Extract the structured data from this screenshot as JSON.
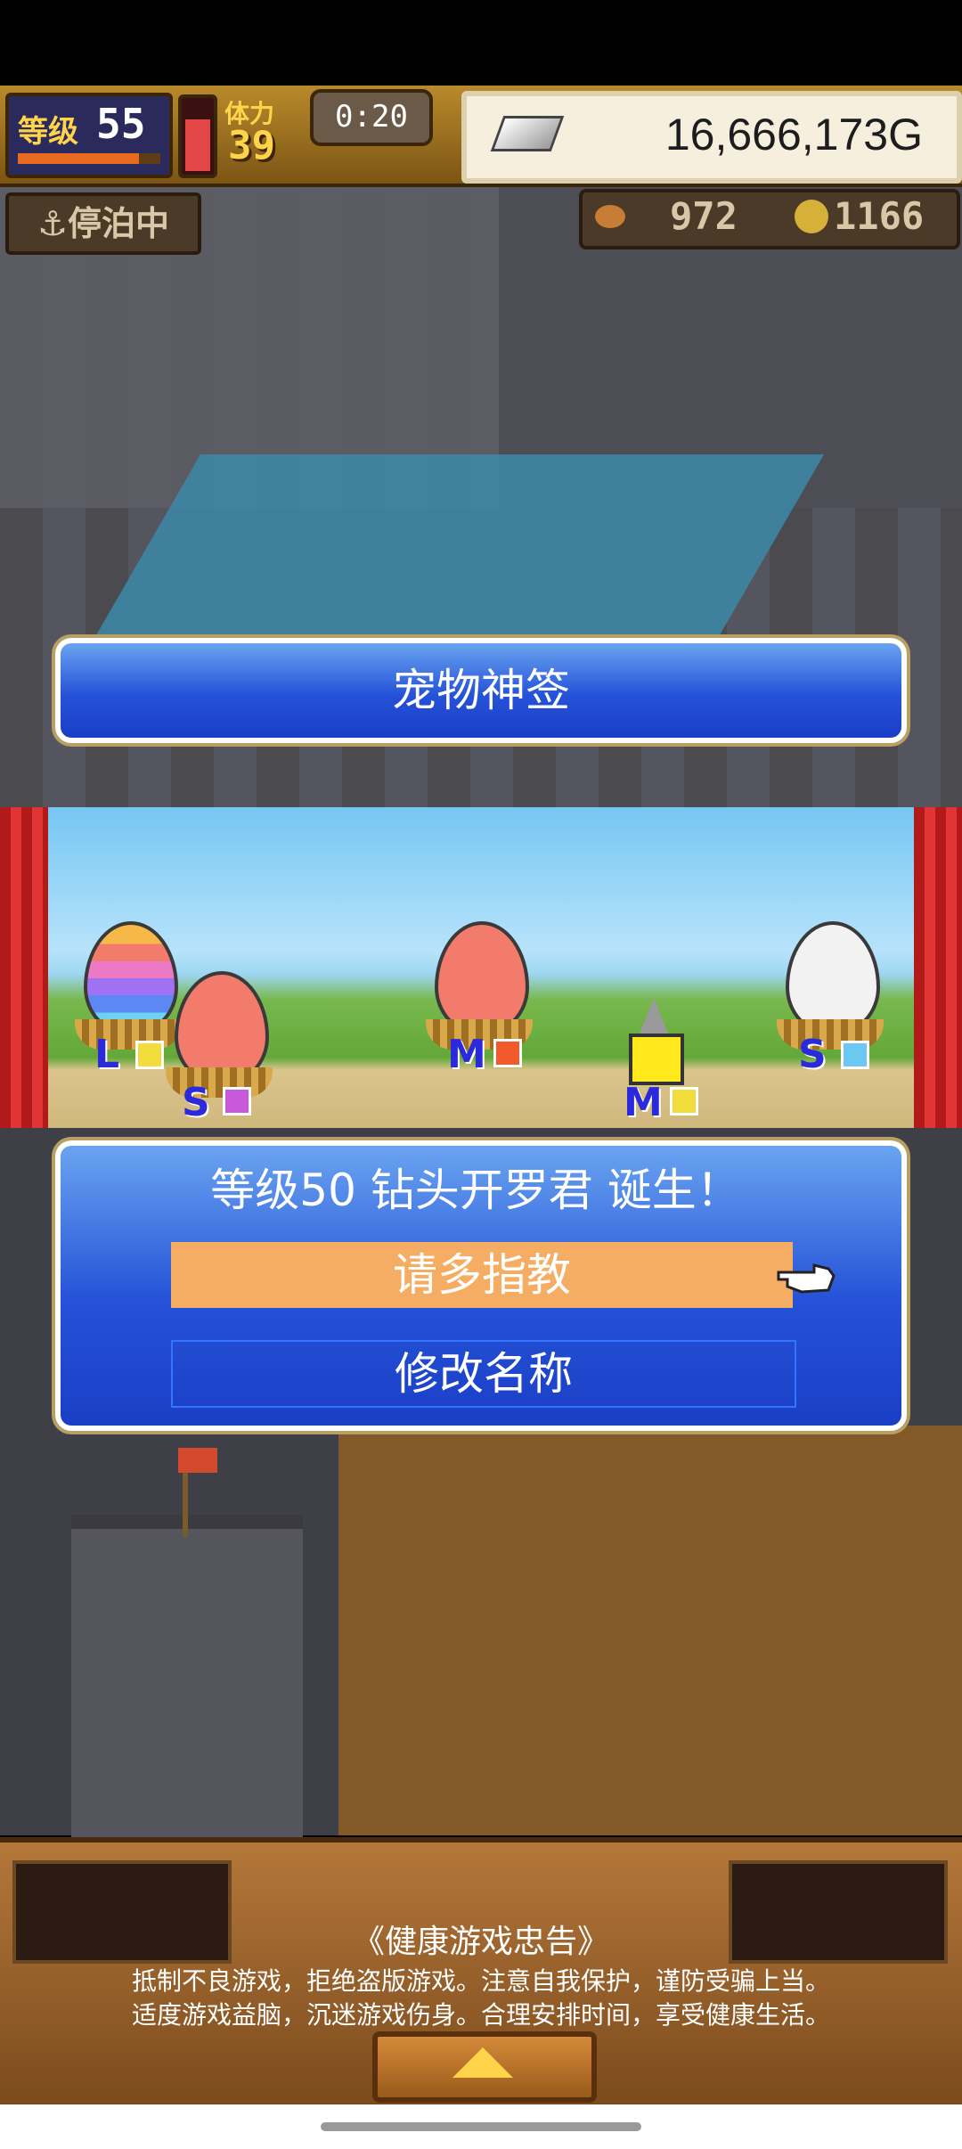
{
  "hud": {
    "level_label": "等级",
    "level_value": "55",
    "level_progress": 0.85,
    "stamina_label": "体力",
    "stamina_value": "39",
    "stamina_fill": 0.75,
    "timer": "0:20",
    "gold": "16,666,173G"
  },
  "status": {
    "docked_label": "停泊中",
    "food_value": "972",
    "coin_value": "1166"
  },
  "dialog": {
    "title": "宠物神签",
    "result_text": "等级50 钻头开罗君 诞生！",
    "confirm_button": "请多指教",
    "rename_button": "修改名称"
  },
  "eggs": [
    {
      "size_label": "L",
      "color": "rainbow",
      "element": "lightning"
    },
    {
      "size_label": "S",
      "color": "#f27b6b",
      "element": "purple"
    },
    {
      "size_label": "M",
      "color": "#f27b6b",
      "element": "fire"
    },
    {
      "size_label": "M",
      "color": "drill-pet",
      "element": "lightning"
    },
    {
      "size_label": "S",
      "color": "#f2f2f2",
      "element": "ice"
    }
  ],
  "notice": {
    "title": "《健康游戏忠告》",
    "line1": "抵制不良游戏，拒绝盗版游戏。注意自我保护，谨防受骗上当。",
    "line2": "适度游戏益脑，沉迷游戏伤身。合理安排时间，享受健康生活。"
  }
}
